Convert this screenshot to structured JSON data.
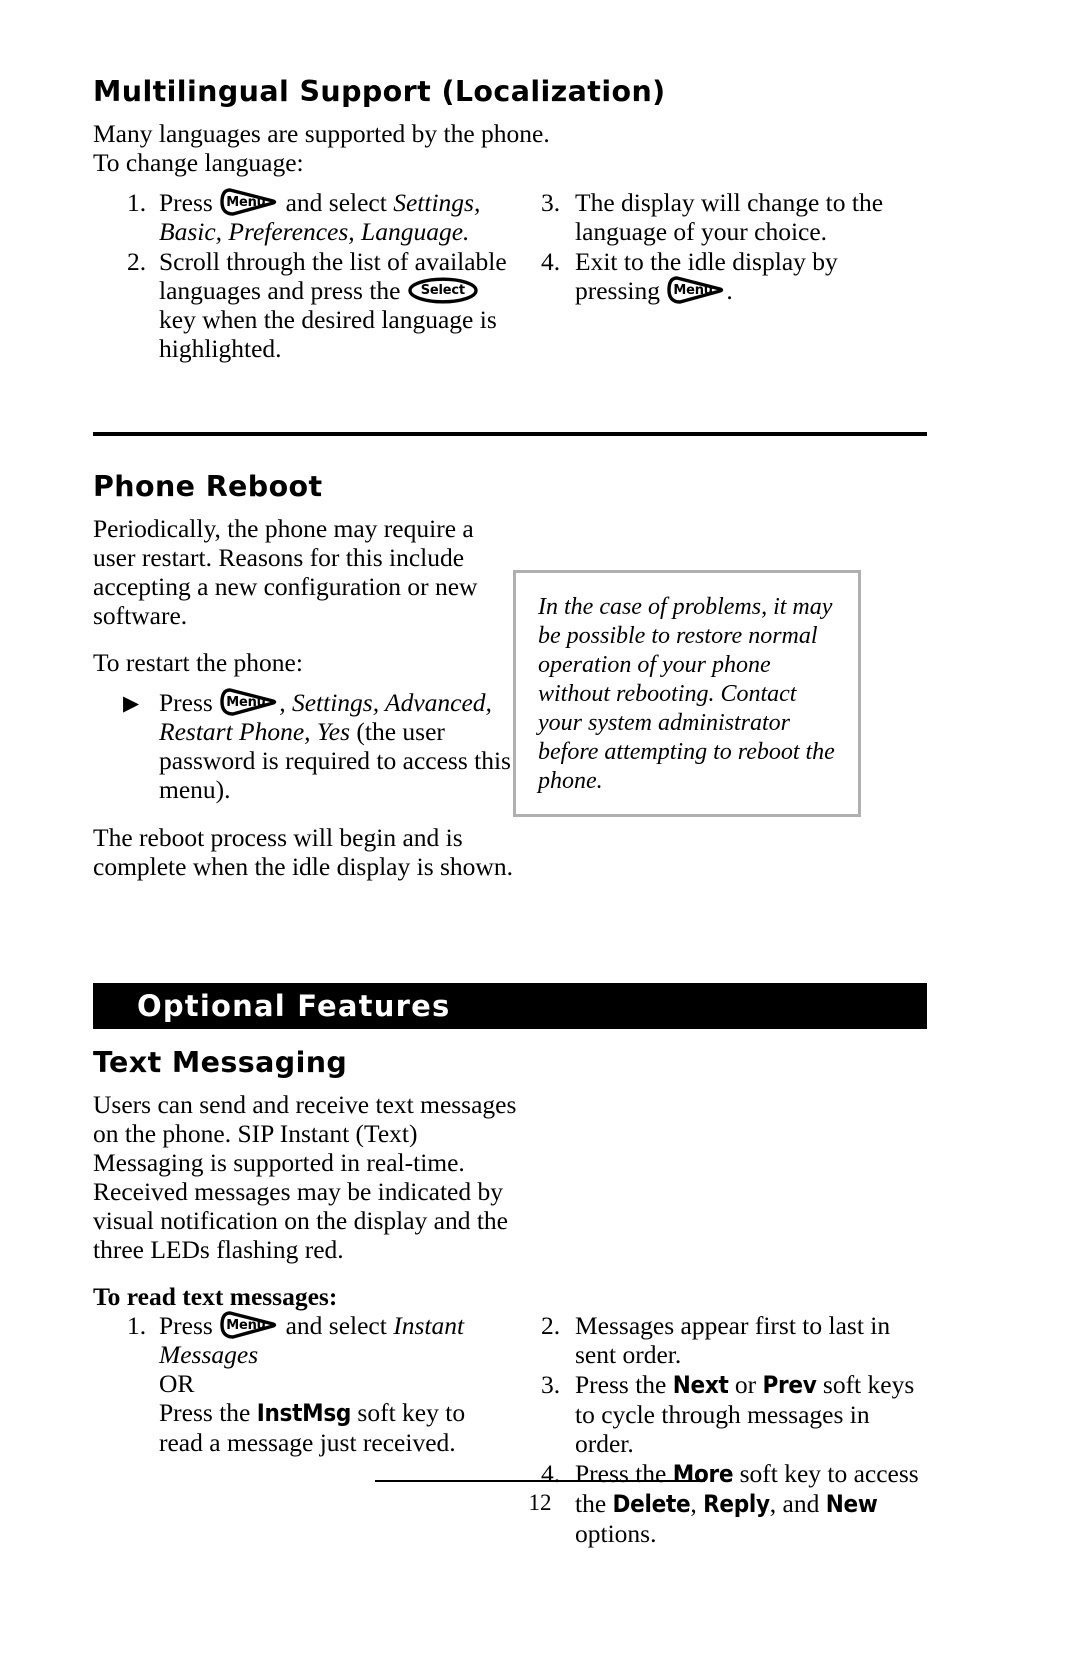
{
  "page": {
    "number": "12"
  },
  "sections": [
    {
      "id": "multilingual",
      "heading": "Multilingual Support (Localization)",
      "intro": "Many languages are supported by the phone.  To change language:",
      "left_steps": [
        {
          "num": "1.",
          "pre": "Press",
          "key": "Menu",
          "mid": "and select",
          "italic": "Settings, Basic, Preferences, Language."
        },
        {
          "num": "2.",
          "pre": "Scroll through the list of available languages and press the",
          "key": "Select",
          "post": "key when the desired language is highlighted."
        }
      ],
      "right_steps": [
        {
          "num": "3.",
          "text": "The display will change to the language of your choice."
        },
        {
          "num": "4.",
          "pre": "Exit to the idle display by pressing",
          "key": "Menu",
          "post": "."
        }
      ]
    },
    {
      "id": "phone-reboot",
      "heading": "Phone Reboot",
      "para1": "Periodically, the phone may require a user restart.  Reasons for this include accepting a new configuration or new software.",
      "para2": "To restart the phone:",
      "bullet": {
        "marker": "▶",
        "pre": "Press",
        "key": "Menu",
        "italic": ", Settings, Advanced, Restart Phone, Yes",
        "post": "(the user password is required to access this menu)."
      },
      "para3": "The reboot process will begin and is complete when the idle display is shown.",
      "note": "In the case of problems, it may be possible to restore normal operation of your phone without rebooting.  Contact your system administrator before attempting to reboot the phone."
    },
    {
      "id": "optional-features",
      "banner": "Optional Features",
      "heading": "Text Messaging",
      "para1": "Users can send and receive text messages on the phone.  SIP Instant (Text) Messaging is supported in real-time.  Received messages may be indicated by visual notification on the display and the three LEDs flashing red.",
      "subhead": "To read text messages:",
      "left_steps": [
        {
          "num": "1.",
          "pre": "Press",
          "key": "Menu",
          "mid": "and select",
          "italic": "Instant Messages",
          "or": "OR",
          "alt_pre": "Press the",
          "alt_key": "InstMsg",
          "alt_post": "soft key to read a message just received."
        }
      ],
      "right_steps": [
        {
          "num": "2.",
          "text": "Messages appear first to last in sent order."
        },
        {
          "num": "3.",
          "pre": "Press the",
          "key1": "Next",
          "mid": "or",
          "key2": "Prev",
          "post": "soft keys to cycle through messages in order."
        },
        {
          "num": "4.",
          "pre": "Press the",
          "key1": "More",
          "mid": "soft key to access the",
          "key2": "Delete",
          "sep1": ",",
          "key3": "Reply",
          "sep2": ", and",
          "key4": "New",
          "post": "options."
        }
      ]
    }
  ],
  "colors": {
    "banner_background": "#000000",
    "banner_text": "#ffffff",
    "note_border": "#b0b0b0",
    "rule": "#000000"
  }
}
